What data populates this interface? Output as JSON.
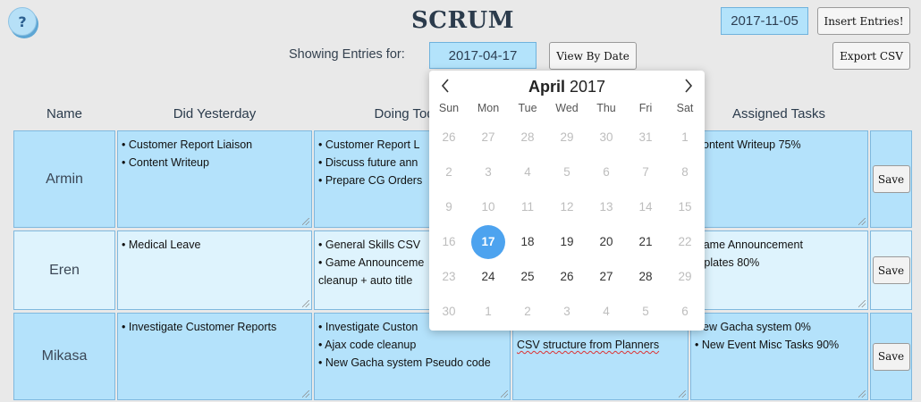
{
  "app": {
    "title": "SCRUM",
    "help_label": "?"
  },
  "header": {
    "current_date": "2017-11-05",
    "insert_label": "Insert Entries!",
    "showing_label": "Showing Entries for:",
    "showing_date": "2017-04-17",
    "view_by_date_label": "View By Date",
    "export_label": "Export CSV"
  },
  "table": {
    "headers": [
      "Name",
      "Did Yesterday",
      "Doing Today",
      "",
      "Assigned Tasks"
    ],
    "save_label": "Save",
    "rows": [
      {
        "name": "Armin",
        "did_yesterday": [
          "• Customer Report Liaison",
          "• Content Writeup"
        ],
        "doing_today": [
          "• Customer Report L",
          "• Discuss future ann",
          "• Prepare CG Orders"
        ],
        "blockers": [],
        "assigned_tasks": [
          "Content Writeup 75%"
        ]
      },
      {
        "name": "Eren",
        "did_yesterday": [
          "• Medical Leave"
        ],
        "doing_today": [
          "• General Skills CSV",
          "• Game Announceme",
          "cleanup + auto title"
        ],
        "blockers": [],
        "assigned_tasks": [
          "Game Announcement",
          "mplates 80%"
        ]
      },
      {
        "name": "Mikasa",
        "did_yesterday": [
          "• Investigate Customer Reports"
        ],
        "doing_today": [
          "• Investigate Custon",
          "• Ajax code cleanup",
          "• New Gacha system Pseudo code"
        ],
        "blockers": [
          "CSV structure from Planners"
        ],
        "assigned_tasks": [
          "New Gacha system 0%",
          "• New Event Misc Tasks 90%"
        ]
      }
    ]
  },
  "calendar": {
    "month": "April",
    "year": "2017",
    "prev_icon": "chevron-left-icon",
    "next_icon": "chevron-right-icon",
    "weekdays": [
      "Sun",
      "Mon",
      "Tue",
      "Wed",
      "Thu",
      "Fri",
      "Sat"
    ],
    "weeks": [
      [
        "26",
        "27",
        "28",
        "29",
        "30",
        "31",
        "1"
      ],
      [
        "2",
        "3",
        "4",
        "5",
        "6",
        "7",
        "8"
      ],
      [
        "9",
        "10",
        "11",
        "12",
        "13",
        "14",
        "15"
      ],
      [
        "16",
        "17",
        "18",
        "19",
        "20",
        "21",
        "22"
      ],
      [
        "23",
        "24",
        "25",
        "26",
        "27",
        "28",
        "29"
      ],
      [
        "30",
        "1",
        "2",
        "3",
        "4",
        "5",
        "6"
      ]
    ],
    "enabled": [
      [
        false,
        false,
        false,
        false,
        false,
        false,
        false
      ],
      [
        false,
        false,
        false,
        false,
        false,
        false,
        false
      ],
      [
        false,
        false,
        false,
        false,
        false,
        false,
        false
      ],
      [
        false,
        true,
        true,
        true,
        true,
        true,
        false
      ],
      [
        false,
        true,
        true,
        true,
        true,
        true,
        false
      ],
      [
        false,
        false,
        false,
        false,
        false,
        false,
        false
      ]
    ],
    "selected_day": "17",
    "accent_color": "#4da3ef"
  }
}
